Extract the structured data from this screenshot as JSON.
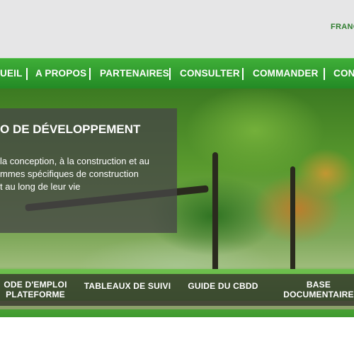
{
  "header": {
    "language": "FRANÇ"
  },
  "nav": {
    "items": [
      "UEIL",
      "A PROPOS",
      "PARTENAIRES",
      "CONSULTER",
      "COMMANDER",
      "CONS"
    ]
  },
  "hero": {
    "title": "O DE DÉVELOPPEMENT",
    "text": [
      "la conception, à la construction et au",
      "mmes spécifiques de construction",
      "t au long de leur vie"
    ]
  },
  "quick_links": [
    {
      "line1": "ODE D'EMPLOI",
      "line2": "PLATEFORME"
    },
    {
      "line1": "TABLEAUX DE SUIVI",
      "line2": ""
    },
    {
      "line1": "GUIDE DU CBDD",
      "line2": ""
    },
    {
      "line1": "BASE",
      "line2": "DOCUMENTAIRE"
    }
  ]
}
